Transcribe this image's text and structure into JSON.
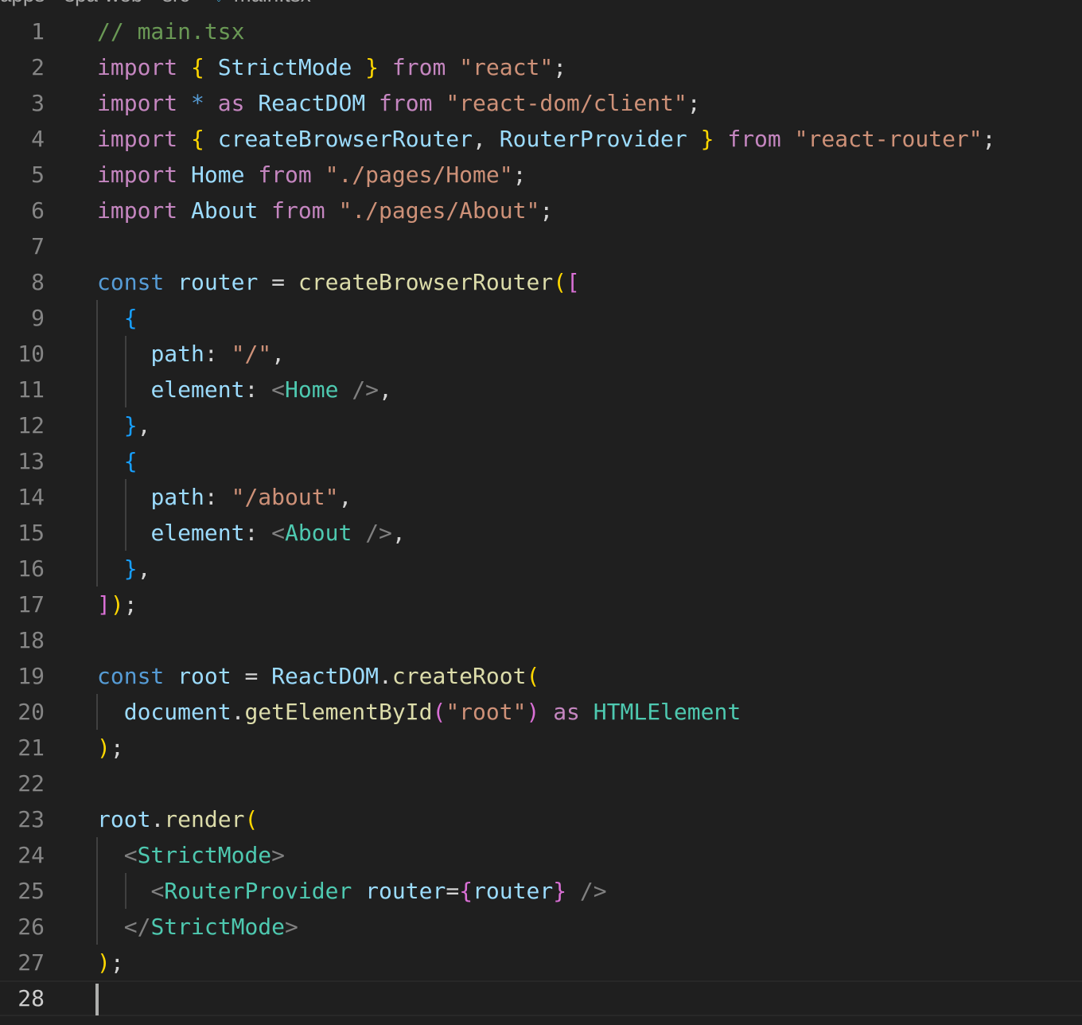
{
  "breadcrumb": {
    "parts": [
      "apps",
      "spa-web",
      "src",
      "main.tsx"
    ]
  },
  "editor": {
    "file_name": "main.tsx",
    "current_line": 28,
    "line_numbers": [
      "1",
      "2",
      "3",
      "4",
      "5",
      "6",
      "7",
      "8",
      "9",
      "10",
      "11",
      "12",
      "13",
      "14",
      "15",
      "16",
      "17",
      "18",
      "19",
      "20",
      "21",
      "22",
      "23",
      "24",
      "25",
      "26",
      "27",
      "28"
    ],
    "lines": [
      "// main.tsx",
      "import { StrictMode } from \"react\";",
      "import * as ReactDOM from \"react-dom/client\";",
      "import { createBrowserRouter, RouterProvider } from \"react-router\";",
      "import Home from \"./pages/Home\";",
      "import About from \"./pages/About\";",
      "",
      "const router = createBrowserRouter([",
      "  {",
      "    path: \"/\",",
      "    element: <Home />,",
      "  },",
      "  {",
      "    path: \"/about\",",
      "    element: <About />,",
      "  },",
      "]);",
      "",
      "const root = ReactDOM.createRoot(",
      "  document.getElementById(\"root\") as HTMLElement",
      ");",
      "",
      "root.render(",
      "  <StrictMode>",
      "    <RouterProvider router={router} />",
      "  </StrictMode>",
      ");",
      ""
    ]
  },
  "colors": {
    "background": "#1f1f1f",
    "comment": "#6a9955",
    "keyword": "#c586c0",
    "declaration": "#569cd6",
    "variable": "#9cdcfe",
    "string": "#ce9178",
    "function": "#dcdcaa",
    "type": "#4ec9b0",
    "bracket_1": "#ffd700",
    "bracket_2": "#da70d6",
    "bracket_3": "#179fff"
  }
}
